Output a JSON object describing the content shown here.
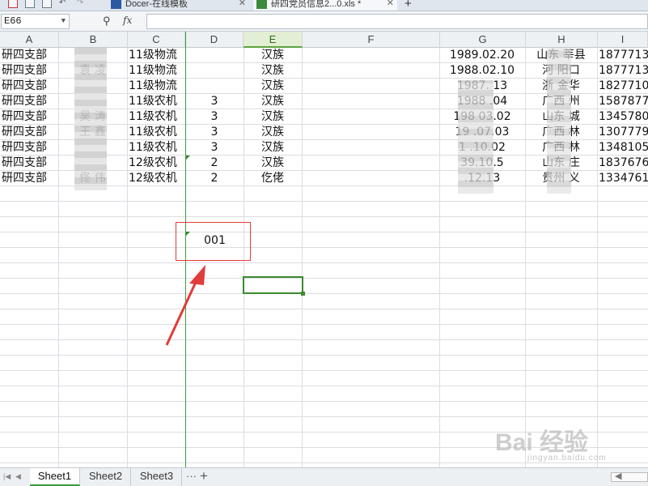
{
  "toolbar_icons": [
    "pdf-icon",
    "print-icon",
    "print-preview-icon",
    "undo-icon",
    "redo-icon"
  ],
  "tabs": [
    {
      "label": "Docer-在线模板",
      "icon": "docer-icon"
    },
    {
      "label": "研四党员信息2...0.xls *",
      "icon": "spreadsheet-icon"
    }
  ],
  "tab_add": "+",
  "namebox": "E66",
  "fx": "fx",
  "columns": [
    "A",
    "B",
    "C",
    "D",
    "E",
    "F",
    "G",
    "H",
    "I"
  ],
  "selected_column": "E",
  "rows": [
    {
      "A": "研四支部",
      "B": "",
      "C": "11级物流",
      "D": "",
      "E": "汉族",
      "G": "1989.02.20",
      "H": "山东   莘县",
      "I": "1877713"
    },
    {
      "A": "研四支部",
      "B": "袁   凌",
      "C": "11级物流",
      "D": "",
      "E": "汉族",
      "G": "1988.02.10",
      "H": "河     阳口",
      "I": "1877713"
    },
    {
      "A": "研四支部",
      "B": "",
      "C": "11级物流",
      "D": "",
      "E": "汉族",
      "G": "1987.   13",
      "H": "浙     金华",
      "I": "1827710"
    },
    {
      "A": "研四支部",
      "B": "",
      "C": "11级农机",
      "D": "3",
      "E": "汉族",
      "G": "1988   .04",
      "H": "广西     州",
      "I": "1587877"
    },
    {
      "A": "研四支部",
      "B": "吴    涛",
      "C": "11级农机",
      "D": "3",
      "E": "汉族",
      "G": "198   03.02",
      "H": "山东   城",
      "I": "1345780"
    },
    {
      "A": "研四支部",
      "B": "王    鑫",
      "C": "11级农机",
      "D": "3",
      "E": "汉族",
      "G": "19   .07.03",
      "H": "广西   林",
      "I": "1307779"
    },
    {
      "A": "研四支部",
      "B": "",
      "C": "11级农机",
      "D": "3",
      "E": "汉族",
      "G": "1   .10.02",
      "H": "广西   林",
      "I": "1348105"
    },
    {
      "A": "研四支部",
      "B": "",
      "C": "12级农机",
      "D": "2",
      "E": "汉族",
      "G": "   39.10.5",
      "H": "山东   庄",
      "I": "1837676"
    },
    {
      "A": "研四支部",
      "B": "佟   伟",
      "C": "12级农机",
      "D": "2",
      "E": "仡佬",
      "G": "   .12.13",
      "H": "贵州   义",
      "I": "1334761"
    }
  ],
  "annotation_cell_value": "001",
  "sheets": [
    "Sheet1",
    "Sheet2",
    "Sheet3"
  ],
  "active_sheet": "Sheet1",
  "sheet_more": "···",
  "sheet_add": "+",
  "watermark": {
    "main": "Bai 经验",
    "sub": "jingyan.baidu.com"
  },
  "colors": {
    "annotation": "#e23b3b",
    "selection": "#3d8a2f",
    "freeze_line": "#3f9a3a"
  }
}
